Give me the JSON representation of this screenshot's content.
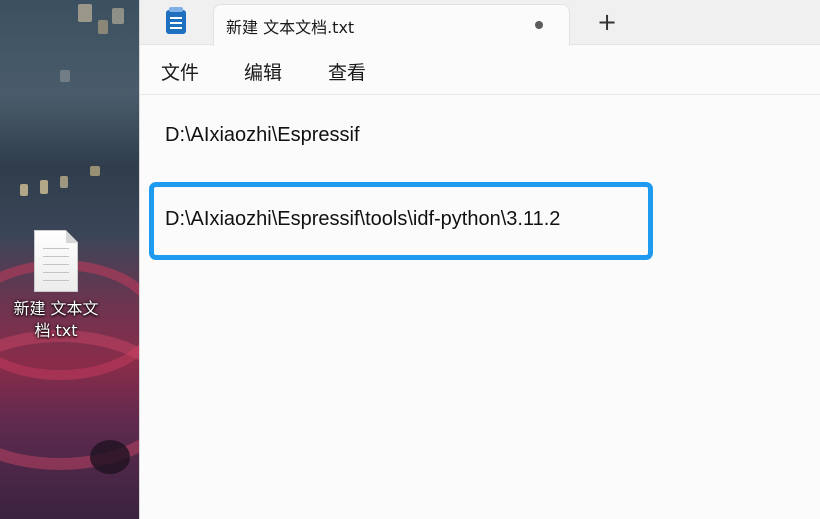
{
  "desktop": {
    "icon_label": "新建 文本文档.txt"
  },
  "window": {
    "tab_title": "新建 文本文档.txt",
    "new_tab_symbol": "+",
    "menu": [
      "文件",
      "编辑",
      "查看"
    ],
    "lines": [
      "D:\\AIxiaozhi\\Espressif",
      "D:\\AIxiaozhi\\Espressif\\tools\\idf-python\\3.11.2"
    ],
    "highlight_color": "#1e9bf0"
  }
}
